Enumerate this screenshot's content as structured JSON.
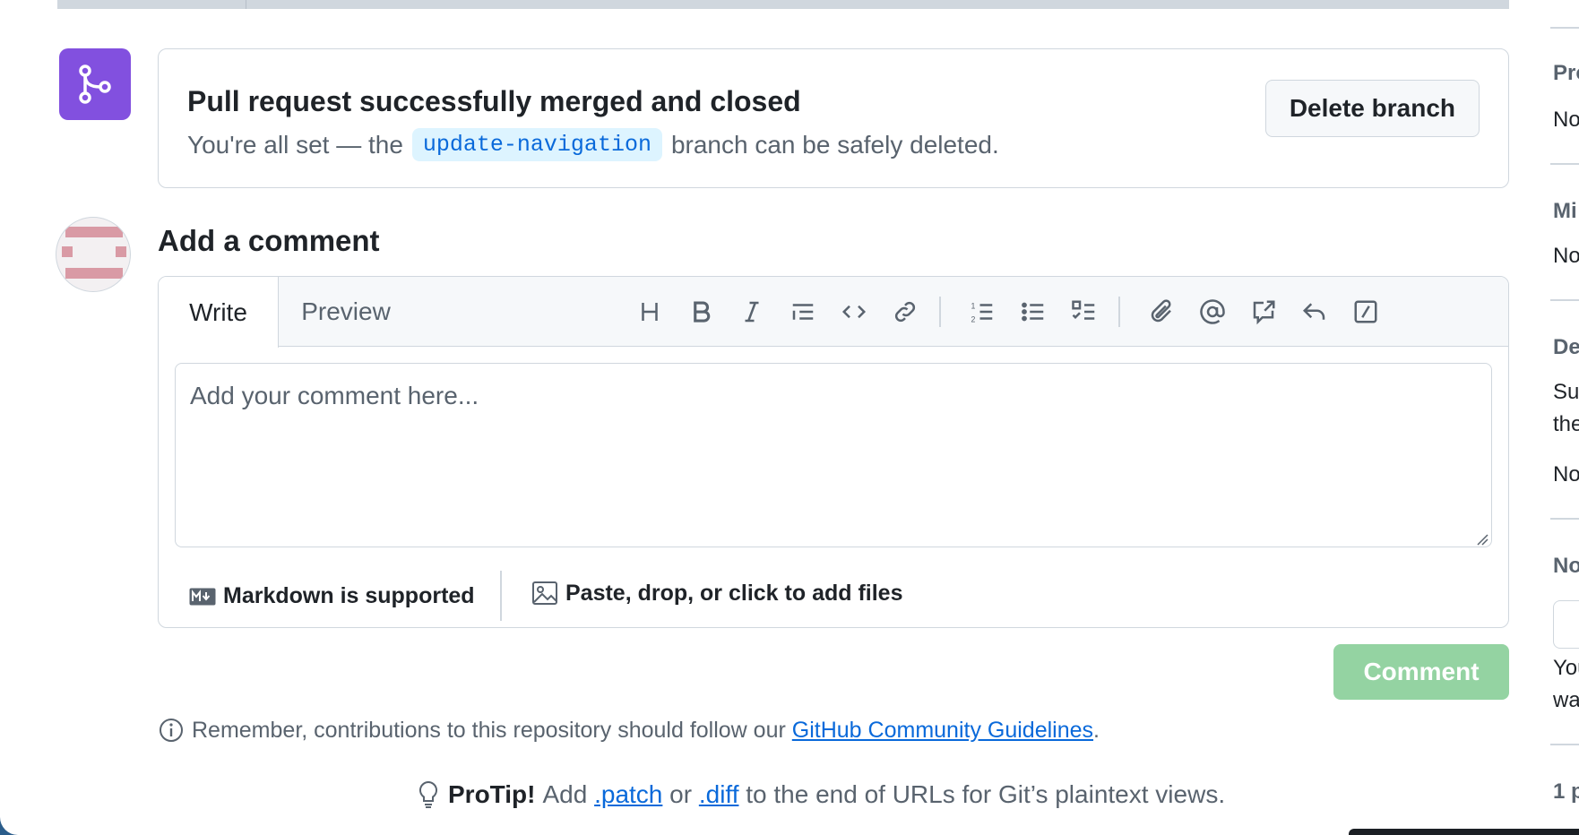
{
  "merge_status": {
    "title": "Pull request successfully merged and closed",
    "sub_prefix": "You're all set — the",
    "branch": "update-navigation",
    "sub_suffix": "branch can be safely deleted.",
    "delete_label": "Delete branch"
  },
  "comment": {
    "heading": "Add a comment",
    "tabs": [
      "Write",
      "Preview"
    ],
    "toolbar_icons": [
      "heading-icon",
      "bold-icon",
      "italic-icon",
      "quote-icon",
      "code-icon",
      "link-icon",
      "numbered-list-icon",
      "unordered-list-icon",
      "task-list-icon",
      "attach-icon",
      "mention-icon",
      "cross-reference-icon",
      "reply-icon",
      "slash-command-icon"
    ],
    "placeholder": "Add your comment here...",
    "markdown_hint": "Markdown is supported",
    "files_hint": "Paste, drop, or click to add files",
    "submit_label": "Comment"
  },
  "footer": {
    "remember_prefix": "Remember, contributions to this repository should follow our",
    "remember_link": "GitHub Community Guidelines",
    "remember_suffix": ".",
    "protip_label": "ProTip!",
    "protip_add": "Add",
    "protip_patch": ".patch",
    "protip_or": "or",
    "protip_diff": ".diff",
    "protip_suffix": "to the end of URLs for Git’s plaintext views."
  },
  "sidebar": {
    "cutoff": [
      "Pro",
      "No",
      "Mi",
      "No",
      "De",
      "Su",
      "the",
      "No",
      "No",
      "You",
      "wa",
      "1 p"
    ]
  },
  "colors": {
    "merged_purple": "#8250df",
    "link_blue": "#0969da",
    "comment_green_disabled": "#94d3a2"
  }
}
